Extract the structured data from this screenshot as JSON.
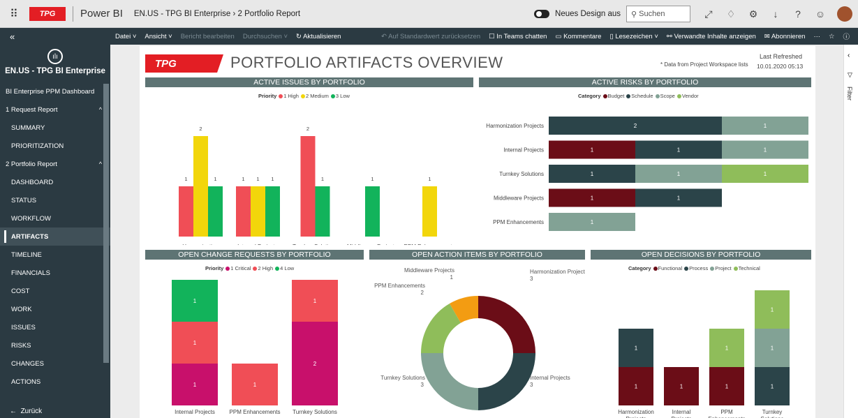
{
  "topbar": {
    "app_logo": "TPG",
    "app_name": "Power BI",
    "breadcrumb": "EN.US - TPG BI Enterprise  ›  2 Portfolio Report",
    "new_design": "Neues Design aus",
    "search_placeholder": "Suchen"
  },
  "cmdbar": {
    "datei": "Datei ˅",
    "ansicht": "Ansicht ˅",
    "bericht": "Bericht bearbeiten",
    "durchsuchen": "Durchsuchen ˅",
    "aktualisieren": "Aktualisieren",
    "reset": "Auf Standardwert zurücksetzen",
    "teams": "In Teams chatten",
    "kommentare": "Kommentare",
    "lesezeichen": "Lesezeichen ˅",
    "verwandte": "Verwandte Inhalte anzeigen",
    "abonnieren": "Abonnieren"
  },
  "sidebar": {
    "workspace": "EN.US - TPG BI Enterprise",
    "items": [
      {
        "label": "BI Enterprise PPM Dashboard",
        "top": true
      },
      {
        "label": "1 Request Report",
        "top": true,
        "chev": "^"
      },
      {
        "label": "SUMMARY"
      },
      {
        "label": "PRIORITIZATION"
      },
      {
        "label": "2 Portfolio Report",
        "top": true,
        "chev": "^"
      },
      {
        "label": "DASHBOARD"
      },
      {
        "label": "STATUS"
      },
      {
        "label": "WORKFLOW"
      },
      {
        "label": "ARTIFACTS",
        "active": true
      },
      {
        "label": "TIMELINE"
      },
      {
        "label": "FINANCIALS"
      },
      {
        "label": "COST"
      },
      {
        "label": "WORK"
      },
      {
        "label": "ISSUES"
      },
      {
        "label": "RISKS"
      },
      {
        "label": "CHANGES"
      },
      {
        "label": "ACTIONS"
      }
    ],
    "back": "Zurück"
  },
  "filter_pane": {
    "label": "Filter"
  },
  "report": {
    "logo": "TPG",
    "title": "PORTFOLIO ARTIFACTS OVERVIEW",
    "note": "* Data from Project Workspace lists",
    "last_refreshed_label": "Last Refreshed",
    "last_refreshed": "10.01.2020 05:13"
  },
  "colors": {
    "red": "#f04e56",
    "yellow": "#f2d60b",
    "green": "#12b35b",
    "maroon": "#6b0d17",
    "dark": "#2b4449",
    "sage": "#82a295",
    "lime": "#8fbd5a",
    "crimson": "#c8106b",
    "orange": "#f39c12"
  },
  "chart_data": [
    {
      "id": "issues",
      "type": "bar",
      "title": "ACTIVE ISSUES BY PORTFOLIO",
      "legend_title": "Priority",
      "categories": [
        "Harmonization Projects",
        "Internal Projects",
        "Turnkey Solutions",
        "Middleware Projects",
        "PPM Enhancements"
      ],
      "series": [
        {
          "name": "1 High",
          "color": "#f04e56",
          "values": [
            1,
            1,
            2,
            0,
            0
          ]
        },
        {
          "name": "2 Medium",
          "color": "#f2d60b",
          "values": [
            2,
            1,
            0,
            0,
            1
          ]
        },
        {
          "name": "3 Low",
          "color": "#12b35b",
          "values": [
            1,
            1,
            1,
            1,
            0
          ]
        }
      ],
      "ylim": [
        0,
        2
      ]
    },
    {
      "id": "risks",
      "type": "bar",
      "orientation": "horizontal",
      "stacked": true,
      "title": "ACTIVE RISKS BY PORTFOLIO",
      "legend_title": "Category",
      "categories": [
        "Harmonization Projects",
        "Internal Projects",
        "Turnkey Solutions",
        "Middleware Projects",
        "PPM Enhancements"
      ],
      "series": [
        {
          "name": "Budget",
          "color": "#6b0d17",
          "values": [
            0,
            1,
            0,
            1,
            0
          ]
        },
        {
          "name": "Schedule",
          "color": "#2b4449",
          "values": [
            2,
            1,
            1,
            1,
            0
          ]
        },
        {
          "name": "Scope",
          "color": "#82a295",
          "values": [
            1,
            1,
            1,
            0,
            1
          ]
        },
        {
          "name": "Vendor",
          "color": "#8fbd5a",
          "values": [
            0,
            0,
            1,
            0,
            0
          ]
        }
      ]
    },
    {
      "id": "changes",
      "type": "bar",
      "stacked": true,
      "title": "OPEN CHANGE REQUESTS BY PORTFOLIO",
      "legend_title": "Priority",
      "categories": [
        "Internal Projects",
        "PPM Enhancements",
        "Turnkey Solutions"
      ],
      "series": [
        {
          "name": "1 Critical",
          "color": "#c8106b",
          "values": [
            1,
            0,
            2
          ]
        },
        {
          "name": "2 High",
          "color": "#f04e56",
          "values": [
            1,
            1,
            1
          ]
        },
        {
          "name": "4 Low",
          "color": "#12b35b",
          "values": [
            1,
            0,
            0
          ]
        }
      ]
    },
    {
      "id": "actions",
      "type": "pie",
      "title": "OPEN ACTION ITEMS BY PORTFOLIO",
      "slices": [
        {
          "label": "Harmonization Projects",
          "value": 3,
          "color": "#6b0d17"
        },
        {
          "label": "Internal Projects",
          "value": 3,
          "color": "#2b4449"
        },
        {
          "label": "Turnkey Solutions",
          "value": 3,
          "color": "#82a295"
        },
        {
          "label": "PPM Enhancements",
          "value": 2,
          "color": "#8fbd5a"
        },
        {
          "label": "Middleware Projects",
          "value": 1,
          "color": "#f39c12"
        }
      ]
    },
    {
      "id": "decisions",
      "type": "bar",
      "stacked": true,
      "title": "OPEN DECISIONS BY PORTFOLIO",
      "legend_title": "Category",
      "categories": [
        "Harmonization Projects",
        "Internal Projects",
        "PPM Enhancements",
        "Turnkey Solutions"
      ],
      "series": [
        {
          "name": "Functional",
          "color": "#6b0d17",
          "values": [
            1,
            1,
            1,
            0
          ]
        },
        {
          "name": "Process",
          "color": "#2b4449",
          "values": [
            1,
            0,
            0,
            1
          ]
        },
        {
          "name": "Project",
          "color": "#82a295",
          "values": [
            0,
            0,
            0,
            1
          ]
        },
        {
          "name": "Technical",
          "color": "#8fbd5a",
          "values": [
            0,
            0,
            1,
            1
          ]
        }
      ]
    }
  ]
}
